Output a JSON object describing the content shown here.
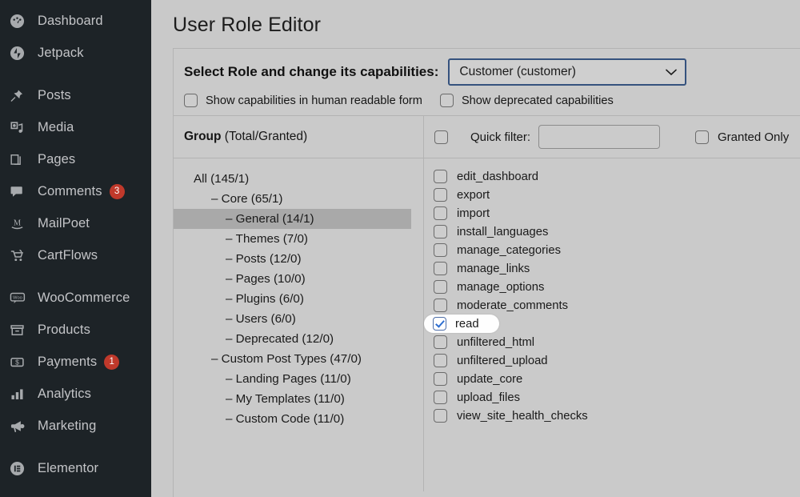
{
  "sidebar": {
    "items": [
      {
        "label": "Dashboard",
        "icon": "dashboard-icon",
        "badge": null,
        "gap": false
      },
      {
        "label": "Jetpack",
        "icon": "jetpack-icon",
        "badge": null,
        "gap": false
      },
      {
        "label": "Posts",
        "icon": "pin-icon",
        "badge": null,
        "gap": true
      },
      {
        "label": "Media",
        "icon": "media-icon",
        "badge": null,
        "gap": false
      },
      {
        "label": "Pages",
        "icon": "pages-icon",
        "badge": null,
        "gap": false
      },
      {
        "label": "Comments",
        "icon": "comment-icon",
        "badge": "3",
        "gap": false
      },
      {
        "label": "MailPoet",
        "icon": "mailpoet-icon",
        "badge": null,
        "gap": false
      },
      {
        "label": "CartFlows",
        "icon": "cart-icon",
        "badge": null,
        "gap": false
      },
      {
        "label": "WooCommerce",
        "icon": "woocommerce-icon",
        "badge": null,
        "gap": true
      },
      {
        "label": "Products",
        "icon": "products-icon",
        "badge": null,
        "gap": false
      },
      {
        "label": "Payments",
        "icon": "payments-icon",
        "badge": "1",
        "gap": false
      },
      {
        "label": "Analytics",
        "icon": "analytics-icon",
        "badge": null,
        "gap": false
      },
      {
        "label": "Marketing",
        "icon": "marketing-icon",
        "badge": null,
        "gap": false
      },
      {
        "label": "Elementor",
        "icon": "elementor-icon",
        "badge": null,
        "gap": true
      }
    ]
  },
  "page": {
    "title": "User Role Editor"
  },
  "role": {
    "label": "Select Role and change its capabilities:",
    "selected": "Customer (customer)",
    "chevron_icon": "chevron-down-icon",
    "accent_border": "#35527e"
  },
  "options": [
    {
      "label": "Show capabilities in human readable form",
      "checked": false
    },
    {
      "label": "Show deprecated capabilities",
      "checked": false
    }
  ],
  "group_panel": {
    "header_bold": "Group",
    "header_rest": " (Total/Granted)",
    "tree": [
      {
        "label": "All (145/1)",
        "level": 0,
        "dash": false,
        "selected": false
      },
      {
        "label": "Core (65/1)",
        "level": 1,
        "dash": true,
        "selected": false
      },
      {
        "label": "General (14/1)",
        "level": 2,
        "dash": true,
        "selected": true
      },
      {
        "label": "Themes (7/0)",
        "level": 2,
        "dash": true,
        "selected": false
      },
      {
        "label": "Posts (12/0)",
        "level": 2,
        "dash": true,
        "selected": false
      },
      {
        "label": "Pages (10/0)",
        "level": 2,
        "dash": true,
        "selected": false
      },
      {
        "label": "Plugins (6/0)",
        "level": 2,
        "dash": true,
        "selected": false
      },
      {
        "label": "Users (6/0)",
        "level": 2,
        "dash": true,
        "selected": false
      },
      {
        "label": "Deprecated (12/0)",
        "level": 2,
        "dash": true,
        "selected": false
      },
      {
        "label": "Custom Post Types (47/0)",
        "level": 1,
        "dash": true,
        "selected": false
      },
      {
        "label": "Landing Pages (11/0)",
        "level": 2,
        "dash": true,
        "selected": false
      },
      {
        "label": "My Templates (11/0)",
        "level": 2,
        "dash": true,
        "selected": false
      },
      {
        "label": "Custom Code (11/0)",
        "level": 2,
        "dash": true,
        "selected": false
      }
    ]
  },
  "caps_panel": {
    "select_all_checked": false,
    "quick_filter_label": "Quick filter:",
    "quick_filter_value": "",
    "quick_filter_placeholder": "",
    "granted_only_label": "Granted Only",
    "granted_only_checked": false,
    "capabilities": [
      {
        "name": "edit_dashboard",
        "checked": false,
        "focused": false
      },
      {
        "name": "export",
        "checked": false,
        "focused": false
      },
      {
        "name": "import",
        "checked": false,
        "focused": false
      },
      {
        "name": "install_languages",
        "checked": false,
        "focused": false
      },
      {
        "name": "manage_categories",
        "checked": false,
        "focused": false
      },
      {
        "name": "manage_links",
        "checked": false,
        "focused": false
      },
      {
        "name": "manage_options",
        "checked": false,
        "focused": false
      },
      {
        "name": "moderate_comments",
        "checked": false,
        "focused": false
      },
      {
        "name": "read",
        "checked": true,
        "focused": true
      },
      {
        "name": "unfiltered_html",
        "checked": false,
        "focused": false
      },
      {
        "name": "unfiltered_upload",
        "checked": false,
        "focused": false
      },
      {
        "name": "update_core",
        "checked": false,
        "focused": false
      },
      {
        "name": "upload_files",
        "checked": false,
        "focused": false
      },
      {
        "name": "view_site_health_checks",
        "checked": false,
        "focused": false
      }
    ]
  }
}
